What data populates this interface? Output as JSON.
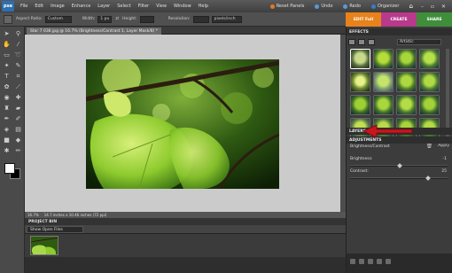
{
  "app": {
    "logo": "pse"
  },
  "menu": [
    "File",
    "Edit",
    "Image",
    "Enhance",
    "Layer",
    "Select",
    "Filter",
    "View",
    "Window",
    "Help"
  ],
  "menu_right": {
    "reset_panels": "Reset Panels",
    "undo": "Undo",
    "redo": "Redo",
    "organizer": "Organizer"
  },
  "options": {
    "aspect_label": "Aspect Ratio:",
    "aspect_value": "Custom",
    "width_label": "Width:",
    "width_value": "1 px",
    "height_label": "Height:",
    "resolution_label": "Resolution:",
    "resolution_value": "pixels/inch"
  },
  "modes": {
    "edit": "EDIT Full",
    "create": "CREATE",
    "share": "SHARE"
  },
  "document": {
    "tab": "Star 7 036.jpg @ 16.7% (Brightness/Contrast 1, Layer Mask/8) *",
    "zoom": "16.7%",
    "size": "14.7 inches x 10.46 inches (72 ppi)"
  },
  "project_bin": {
    "title": "PROJECT BIN",
    "select": "Show Open Files"
  },
  "panels": {
    "effects_title": "EFFECTS",
    "effects_select": "Artistic",
    "apply": "Apply",
    "layers_title": "LAYERS",
    "adjustments_title": "ADJUSTMENTS",
    "adjustment_name": "Brightness/Contrast",
    "brightness_label": "Brightness:",
    "brightness_value": "-1",
    "contrast_label": "Contrast:",
    "contrast_value": "25"
  },
  "colors": {
    "edit_tab": "#e8821c",
    "create_tab": "#b9398d",
    "share_tab": "#3f8e3a",
    "arrow": "#c8161c"
  }
}
